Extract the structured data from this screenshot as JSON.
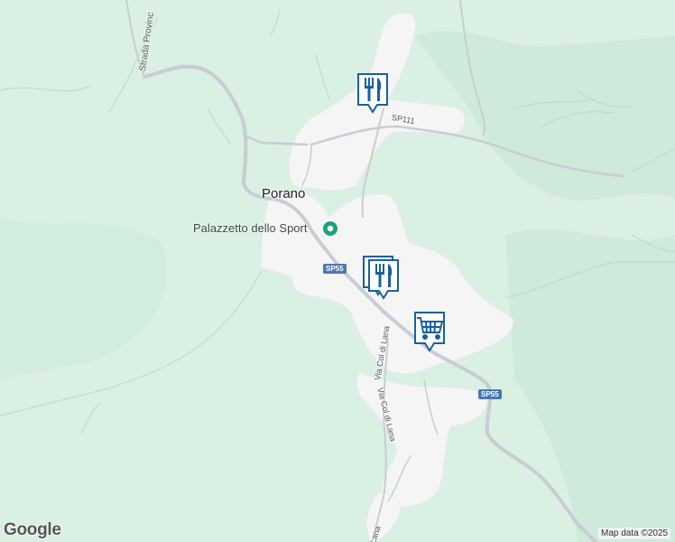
{
  "map": {
    "background_color": "#d9f0e3",
    "road_color": "#c9cdd3",
    "urban_color": "#f5f5f6",
    "marker_color": "#1a5fa0"
  },
  "labels": {
    "town": "Porano",
    "poi": "Palazzetto dello Sport",
    "road_strada": "Strada Provinc",
    "road_sp111": "SP111",
    "road_via_1": "Via Col di Lana",
    "road_via_2": "Via Col di Lana",
    "road_lana": "Lana"
  },
  "shields": {
    "sp55_north": "SP55",
    "sp55_south": "SP55"
  },
  "markers": [
    {
      "icon": "restaurant-icon"
    },
    {
      "icon": "restaurant-icon"
    },
    {
      "icon": "shopping-cart-icon"
    }
  ],
  "footer": {
    "logo": "Google",
    "attribution": "Map data ©2025"
  }
}
